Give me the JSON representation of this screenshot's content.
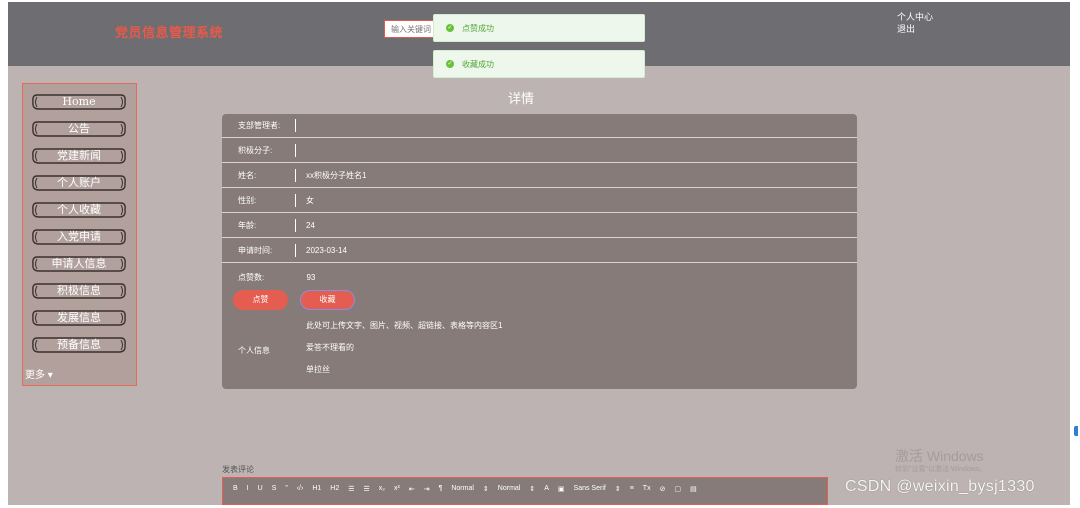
{
  "header": {
    "brand": "党员信息管理系统",
    "search_placeholder": "输入关键词",
    "user_center": "个人中心",
    "logout": "退出"
  },
  "toasts": [
    {
      "text": "点赞成功"
    },
    {
      "text": "收藏成功"
    }
  ],
  "sidebar": {
    "items": [
      {
        "label": "Home"
      },
      {
        "label": "公告"
      },
      {
        "label": "党建新闻"
      },
      {
        "label": "个人账户"
      },
      {
        "label": "个人收藏"
      },
      {
        "label": "入党申请"
      },
      {
        "label": "申请人信息"
      },
      {
        "label": "积极信息"
      },
      {
        "label": "发展信息"
      },
      {
        "label": "预备信息"
      }
    ],
    "more": "更多"
  },
  "page_title": "详情",
  "detail": {
    "rows": [
      {
        "label": "支部管理者:",
        "value": ""
      },
      {
        "label": "积极分子:",
        "value": ""
      },
      {
        "label": "姓名:",
        "value": "xx积极分子姓名1"
      },
      {
        "label": "性别:",
        "value": "女"
      },
      {
        "label": "年龄:",
        "value": "24"
      },
      {
        "label": "申请时间:",
        "value": "2023-03-14"
      }
    ],
    "likes_label": "点赞数:",
    "likes_value": "93",
    "like_button": "点赞",
    "favorite_button": "收藏",
    "info_label": "个人信息",
    "info_lines": [
      "此处可上传文字、图片、视频、超链接、表格等内容区1",
      "爱答不理看的",
      "单拉丝"
    ]
  },
  "comment": {
    "label": "发表评论",
    "toolbar": [
      "B",
      "I",
      "U",
      "S",
      "”",
      "‹/›",
      "H1",
      "H2",
      "☰",
      "☰",
      "x₂",
      "x²",
      "⇤",
      "⇥",
      "¶",
      "Normal",
      "⇕",
      "Normal",
      "⇕",
      "A",
      "▣",
      "Sans Serif",
      "⇕",
      "≡",
      "Tx",
      "⊘",
      "▢",
      "▤"
    ]
  },
  "watermark": {
    "title": "激活 Windows",
    "subtitle": "转到\"设置\"以激活 Windows。"
  },
  "credit": "CSDN @weixin_bysj1330",
  "colors": {
    "background": "#bdb3b3",
    "header": "#6e6d71",
    "accent": "#e55d50",
    "card": "#867b78",
    "success": "#67c23a"
  }
}
